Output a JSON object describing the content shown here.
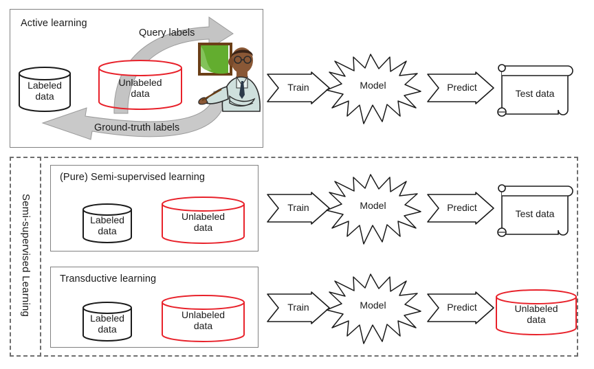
{
  "diagram": {
    "title_vertical": "Semi-supervised Learning",
    "active_learning": {
      "title": "Active learning",
      "labeled_data": "Labeled\ndata",
      "unlabeled_data": "Unlabeled\ndata",
      "query_labels": "Query labels",
      "ground_truth_labels": "Ground-truth labels",
      "teacher_icon": "teacher-pointing-at-chalkboard",
      "train_arrow": "Train",
      "model": "Model",
      "predict_arrow": "Predict",
      "output": "Test data"
    },
    "pure_semi_supervised": {
      "title": "(Pure) Semi-supervised learning",
      "labeled_data": "Labeled\ndata",
      "unlabeled_data": "Unlabeled\ndata",
      "train_arrow": "Train",
      "model": "Model",
      "predict_arrow": "Predict",
      "output": "Test data"
    },
    "transductive": {
      "title": "Transductive learning",
      "labeled_data": "Labeled\ndata",
      "unlabeled_data": "Unlabeled\ndata",
      "train_arrow": "Train",
      "model": "Model",
      "predict_arrow": "Predict",
      "output": "Unlabeled\ndata"
    },
    "colors": {
      "unlabeled_stroke": "#e8212a",
      "labeled_stroke": "#1a1a1a",
      "panel_border": "#808080",
      "dashed_border": "#6e6e6e",
      "loop_arrow": "#b3b3b3",
      "chalkboard": "#4f9c2a",
      "chalkboard_frame": "#6b3f17",
      "skin": "#7a4a2a",
      "coat": "#cfe0dd"
    }
  }
}
